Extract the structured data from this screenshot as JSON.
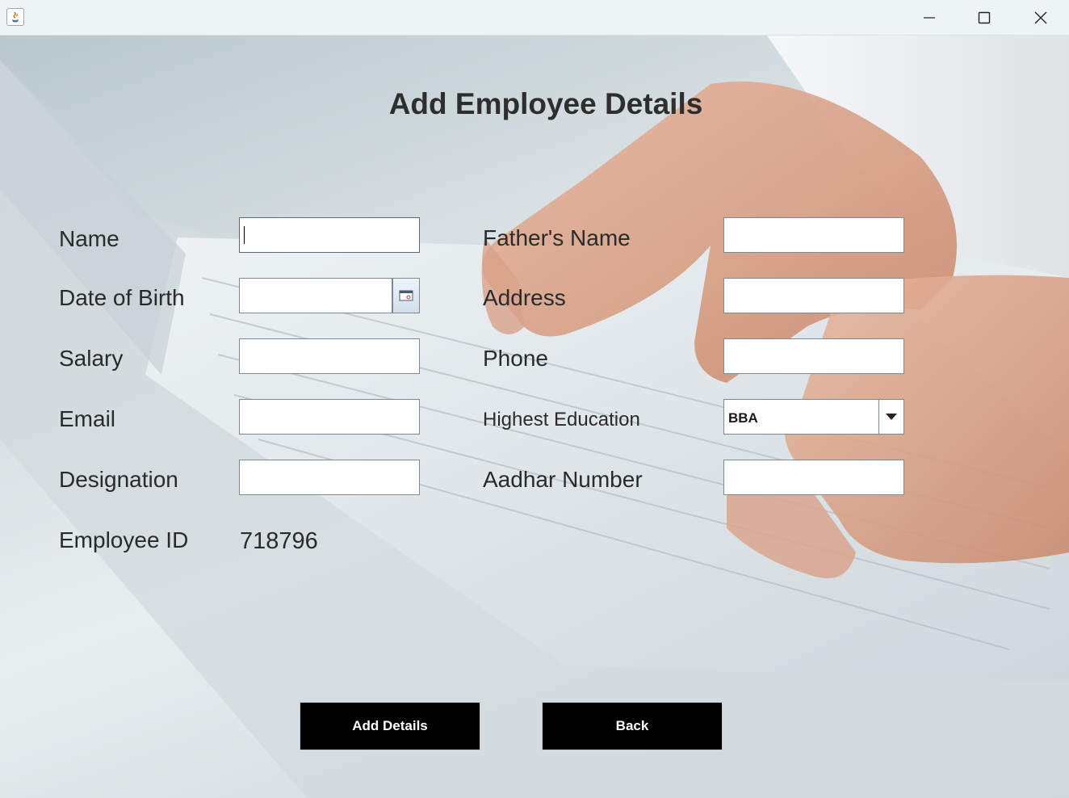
{
  "window": {
    "controls": {
      "minimize_icon": "minimize-icon",
      "maximize_icon": "maximize-icon",
      "close_icon": "close-icon"
    }
  },
  "form": {
    "title": "Add Employee Details",
    "left": {
      "name_label": "Name",
      "dob_label": "Date of Birth",
      "salary_label": "Salary",
      "email_label": "Email",
      "designation_label": "Designation",
      "employee_id_label": "Employee ID",
      "employee_id_value": "718796"
    },
    "right": {
      "fathers_name_label": "Father's Name",
      "address_label": "Address",
      "phone_label": "Phone",
      "education_label": "Highest Education",
      "education_value": "BBA",
      "aadhar_label": "Aadhar Number"
    },
    "fields": {
      "name": "",
      "dob": "",
      "salary": "",
      "email": "",
      "designation": "",
      "fathers_name": "",
      "address": "",
      "phone": "",
      "aadhar": ""
    },
    "buttons": {
      "add": "Add Details",
      "back": "Back"
    }
  },
  "colors": {
    "button_bg": "#000000",
    "button_text": "#ffffff",
    "titlebar_bg": "#eef3f6"
  }
}
